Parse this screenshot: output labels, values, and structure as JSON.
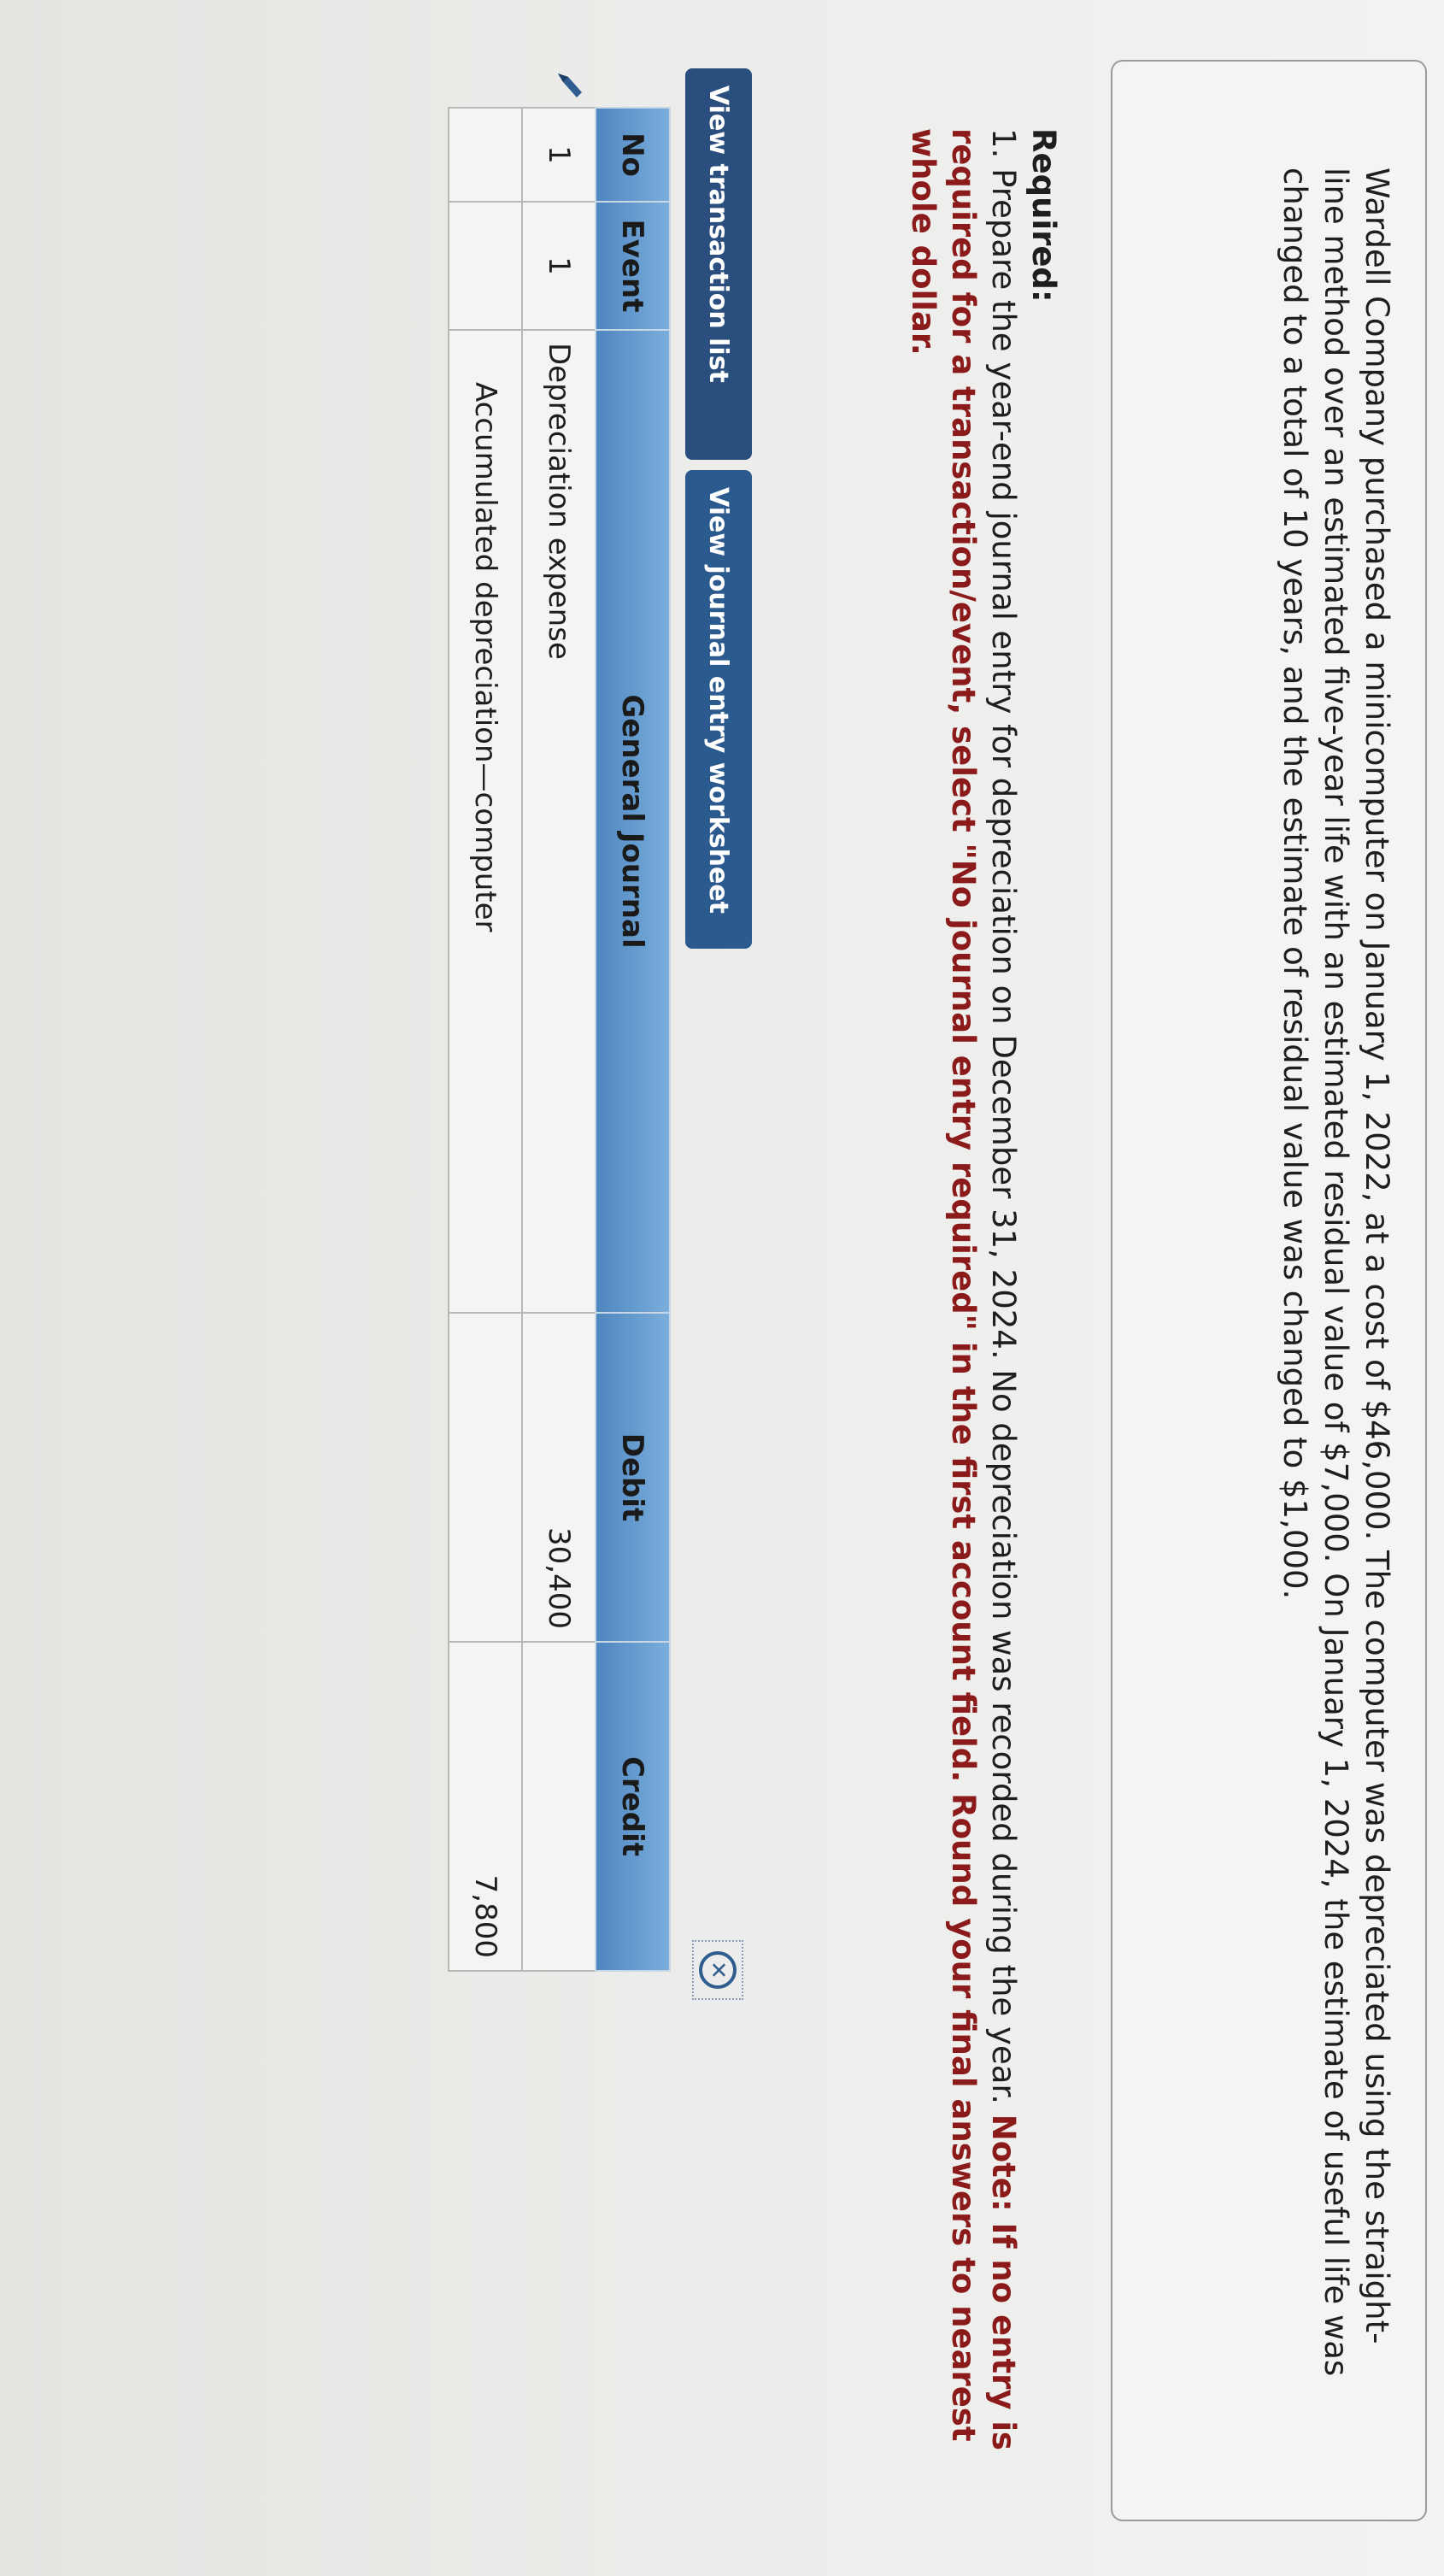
{
  "problem": {
    "text": "Wardell Company purchased a minicomputer on January 1, 2022, at a cost of $46,000. The computer was depreciated using the straight-line method over an estimated five-year life with an estimated residual value of $7,000. On January 1, 2024, the estimate of useful life was changed to a total of 10 years, and the estimate of residual value was changed to $1,000."
  },
  "required": {
    "heading": "Required:",
    "instruction": "1. Prepare the year-end journal entry for depreciation on December 31, 2024. No depreciation was recorded during the year.",
    "note": "Note: If no entry is required for a transaction/event, select \"No journal entry required\" in the first account field. Round your final answers to nearest whole dollar."
  },
  "tabs": {
    "transaction_list": "View transaction list",
    "journal_worksheet": "View journal entry worksheet"
  },
  "table": {
    "headers": {
      "no": "No",
      "event": "Event",
      "general_journal": "General Journal",
      "debit": "Debit",
      "credit": "Credit"
    },
    "rows": [
      {
        "no": "1",
        "event": "1",
        "account": "Depreciation expense",
        "debit": "30,400",
        "credit": ""
      },
      {
        "no": "",
        "event": "",
        "account": "Accumulated depreciation—computer",
        "debit": "",
        "credit": "7,800"
      }
    ]
  }
}
